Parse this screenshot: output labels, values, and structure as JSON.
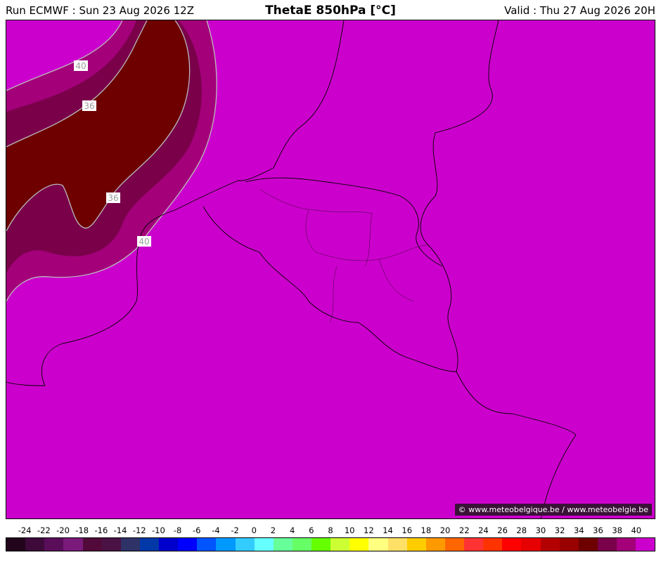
{
  "header": {
    "run": "Run ECMWF : Sun 23 Aug 2026 12Z",
    "title": "ThetaE 850hPa [°C]",
    "valid": "Valid : Thu 27 Aug 2026 20H"
  },
  "map": {
    "background_color": "#cc00cc",
    "contour_labels": [
      "40",
      "36",
      "36",
      "40"
    ],
    "credit": "© www.meteobelgique.be / www.meteobelgie.be"
  },
  "legend": {
    "ticks": [
      "-24",
      "-22",
      "-20",
      "-18",
      "-16",
      "-14",
      "-12",
      "-10",
      "-8",
      "-6",
      "-4",
      "-2",
      "0",
      "2",
      "4",
      "6",
      "8",
      "10",
      "12",
      "14",
      "16",
      "18",
      "20",
      "22",
      "24",
      "26",
      "28",
      "30",
      "32",
      "34",
      "36",
      "38",
      "40"
    ],
    "colors": [
      "#22041c",
      "#3d0a3a",
      "#5a0e5a",
      "#7a1a7a",
      "#520a3a",
      "#4a1245",
      "#2e3266",
      "#0038a8",
      "#0000cc",
      "#0000ff",
      "#0055ff",
      "#0099ff",
      "#33ccff",
      "#66ffff",
      "#66ff99",
      "#66ff66",
      "#66ff00",
      "#ccff33",
      "#ffff00",
      "#ffff80",
      "#ffe066",
      "#ffcc00",
      "#ff9900",
      "#ff6600",
      "#ff3333",
      "#ff3300",
      "#ff0000",
      "#e60000",
      "#b30000",
      "#990000",
      "#6e0000",
      "#7a004a",
      "#a3007a",
      "#cc00cc"
    ]
  }
}
